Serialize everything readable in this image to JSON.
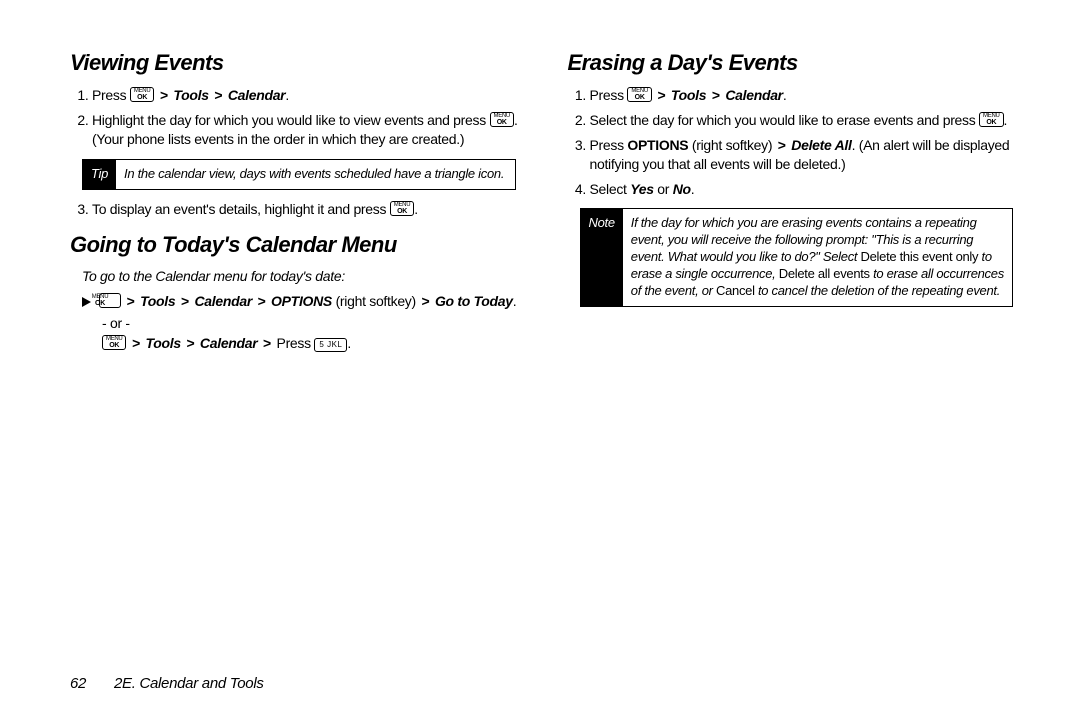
{
  "left": {
    "h_view": "Viewing Events",
    "s1_a": "Press ",
    "s1_b": " Tools ",
    "s1_c": " Calendar",
    "s2_a": "Highlight the day for which you would like to view events and press ",
    "s2_b": ". (Your phone lists events in the order in which they are created.)",
    "tip_label": "Tip",
    "tip_body": "In the calendar view, days with events scheduled have a triangle icon.",
    "s3_a": "To display an event's details, highlight it and press ",
    "h_today": "Going to Today's Calendar Menu",
    "intro_today": "To go to the Calendar menu for today's date:",
    "a1_a": " Tools ",
    "a1_b": " Calendar ",
    "a1_c": " OPTIONS ",
    "a1_d": "(right softkey) ",
    "a1_e": "Go to Today",
    "or": "- or -",
    "a2_a": " Tools ",
    "a2_b": " Calendar ",
    "a2_c": " Press "
  },
  "right": {
    "h_erase": "Erasing a Day's Events",
    "s1_a": "Press ",
    "s1_b": " Tools ",
    "s1_c": " Calendar",
    "s2_a": "Select the day for which you would like to erase events and press ",
    "s3_a": "Press ",
    "s3_b": "OPTIONS",
    "s3_c": " (right softkey) ",
    "s3_d": " Delete All",
    "s3_e": ". (An alert will be displayed notifying you that all events will be deleted.)",
    "s4_a": "Select ",
    "s4_b": "Yes",
    "s4_c": " or ",
    "s4_d": "No",
    "note_label": "Note",
    "note_a": "If the day for which you are erasing events contains a repeating event, you will receive the following prompt: \"This is a recurring event. What would you like to do?\" Select ",
    "note_b": "Delete this event only",
    "note_c": " to erase a single occurrence, ",
    "note_d": "Delete all events",
    "note_e": " to erase all occurrences of the event, or ",
    "note_f": "Cancel",
    "note_g": " to cancel the deletion of the repeating event."
  },
  "keys": {
    "menu_top": "MENU",
    "menu_bot": "OK",
    "five": "5 JKL"
  },
  "gt": ">",
  "period": ".",
  "footer": {
    "page": "62",
    "title": "2E. Calendar and Tools"
  }
}
